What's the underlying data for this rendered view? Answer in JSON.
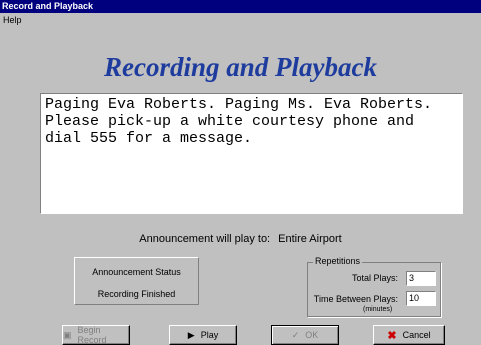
{
  "window": {
    "title": "Record and Playback"
  },
  "menu": {
    "items": [
      "Help"
    ]
  },
  "heading": "Recording and Playback",
  "message": "Paging Eva Roberts. Paging Ms. Eva Roberts.\nPlease pick-up a white courtesy phone and\ndial 555 for a message.",
  "play_to": {
    "label": "Announcement will play to:",
    "value": "Entire Airport"
  },
  "status": {
    "title": "Announcement Status",
    "value": "Recording Finished"
  },
  "repetitions": {
    "legend": "Repetitions",
    "total_label": "Total Plays:",
    "total_value": "3",
    "between_label": "Time Between Plays:",
    "between_value": "10",
    "between_units": "(minutes)"
  },
  "buttons": {
    "begin_record": "Begin Record",
    "play": "Play",
    "ok": "OK",
    "cancel": "Cancel"
  },
  "icons": {
    "record": "record-icon",
    "play": "play-icon",
    "ok": "check-icon",
    "cancel": "x-icon"
  },
  "colors": {
    "titlebar": "#00007f",
    "heading": "#1e3c9e",
    "cancel_icon": "#cc0000"
  }
}
